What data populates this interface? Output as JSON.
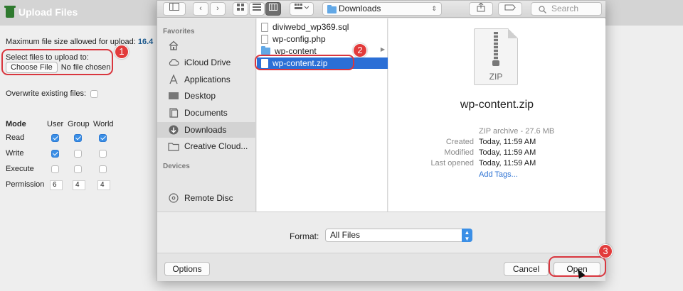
{
  "page": {
    "title": "Upload Files",
    "max_size_label": "Maximum file size allowed for upload:",
    "max_size_value": "16.4",
    "select_label": "Select files to upload to:",
    "choose_button": "Choose File",
    "no_file": "No file chosen",
    "overwrite_label": "Overwrite existing files:",
    "overwrite_checked": false,
    "perm": {
      "headers": [
        "Mode",
        "User",
        "Group",
        "World"
      ],
      "rows": [
        {
          "label": "Read",
          "checks": [
            true,
            true,
            true
          ]
        },
        {
          "label": "Write",
          "checks": [
            true,
            false,
            false
          ]
        },
        {
          "label": "Execute",
          "checks": [
            false,
            false,
            false
          ]
        }
      ],
      "permission_label": "Permission",
      "permission_values": [
        "6",
        "4",
        "4"
      ]
    }
  },
  "dialog": {
    "toolbar": {
      "path": "Downloads",
      "search_placeholder": "Search"
    },
    "sidebar": {
      "favorites_label": "Favorites",
      "devices_label": "Devices",
      "favorites": [
        {
          "label": "",
          "icon": "home-icon"
        },
        {
          "label": "iCloud Drive",
          "icon": "cloud-icon"
        },
        {
          "label": "Applications",
          "icon": "applications-icon"
        },
        {
          "label": "Desktop",
          "icon": "desktop-icon"
        },
        {
          "label": "Documents",
          "icon": "documents-icon"
        },
        {
          "label": "Downloads",
          "icon": "downloads-icon",
          "selected": true
        },
        {
          "label": "Creative Cloud...",
          "icon": "folder-icon"
        }
      ],
      "devices": [
        {
          "label": "Remote Disc",
          "icon": "disc-icon"
        }
      ]
    },
    "files": [
      {
        "name": "diviwebd_wp369.sql",
        "type": "file"
      },
      {
        "name": "wp-config.php",
        "type": "file"
      },
      {
        "name": "wp-content",
        "type": "folder"
      },
      {
        "name": "wp-content.zip",
        "type": "file",
        "selected": true
      }
    ],
    "preview": {
      "icon_label": "ZIP",
      "name": "wp-content.zip",
      "kind": "ZIP archive - 27.6 MB",
      "rows": [
        {
          "k": "Created",
          "v": "Today, 11:59 AM"
        },
        {
          "k": "Modified",
          "v": "Today, 11:59 AM"
        },
        {
          "k": "Last opened",
          "v": "Today, 11:59 AM"
        }
      ],
      "add_tags": "Add Tags..."
    },
    "format": {
      "label": "Format:",
      "value": "All Files"
    },
    "buttons": {
      "options": "Options",
      "cancel": "Cancel",
      "open": "Open"
    }
  },
  "annotations": [
    "1",
    "2",
    "3"
  ],
  "colors": {
    "annotation": "#d9363e",
    "selection": "#2b6fd6",
    "link": "#2e73d3"
  }
}
